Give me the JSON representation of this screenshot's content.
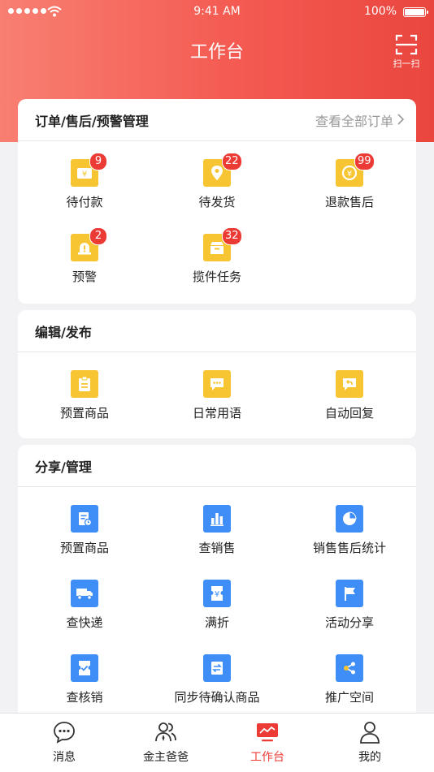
{
  "status_bar": {
    "time": "9:41 AM",
    "battery": "100%"
  },
  "header": {
    "title": "工作台",
    "scan_label": "扫一扫"
  },
  "orders": {
    "title": "订单/售后/预警管理",
    "view_all": "查看全部订单",
    "items": [
      {
        "label": "待付款",
        "badge": "9"
      },
      {
        "label": "待发货",
        "badge": "22"
      },
      {
        "label": "退款售后",
        "badge": "99"
      },
      {
        "label": "预警",
        "badge": "2"
      },
      {
        "label": "揽件任务",
        "badge": "32"
      }
    ]
  },
  "edit": {
    "title": "编辑/发布",
    "items": [
      {
        "label": "预置商品"
      },
      {
        "label": "日常用语"
      },
      {
        "label": "自动回复"
      }
    ]
  },
  "share": {
    "title": "分享/管理",
    "items": [
      {
        "label": "预置商品"
      },
      {
        "label": "查销售"
      },
      {
        "label": "销售售后统计"
      },
      {
        "label": "查快递"
      },
      {
        "label": "满折"
      },
      {
        "label": "活动分享"
      },
      {
        "label": "查核销"
      },
      {
        "label": "同步待确认商品"
      },
      {
        "label": "推广空间"
      }
    ]
  },
  "tabbar": {
    "active": "工作台",
    "accent": "#ec3a35",
    "items": [
      {
        "label": "消息"
      },
      {
        "label": "金主爸爸"
      },
      {
        "label": "工作台"
      },
      {
        "label": "我的"
      }
    ]
  },
  "colors": {
    "header_start": "#f87f72",
    "header_end": "#e9463e",
    "icon_yellow": "#f7c531",
    "icon_blue": "#3f8ef7",
    "badge": "#ec3a35"
  }
}
